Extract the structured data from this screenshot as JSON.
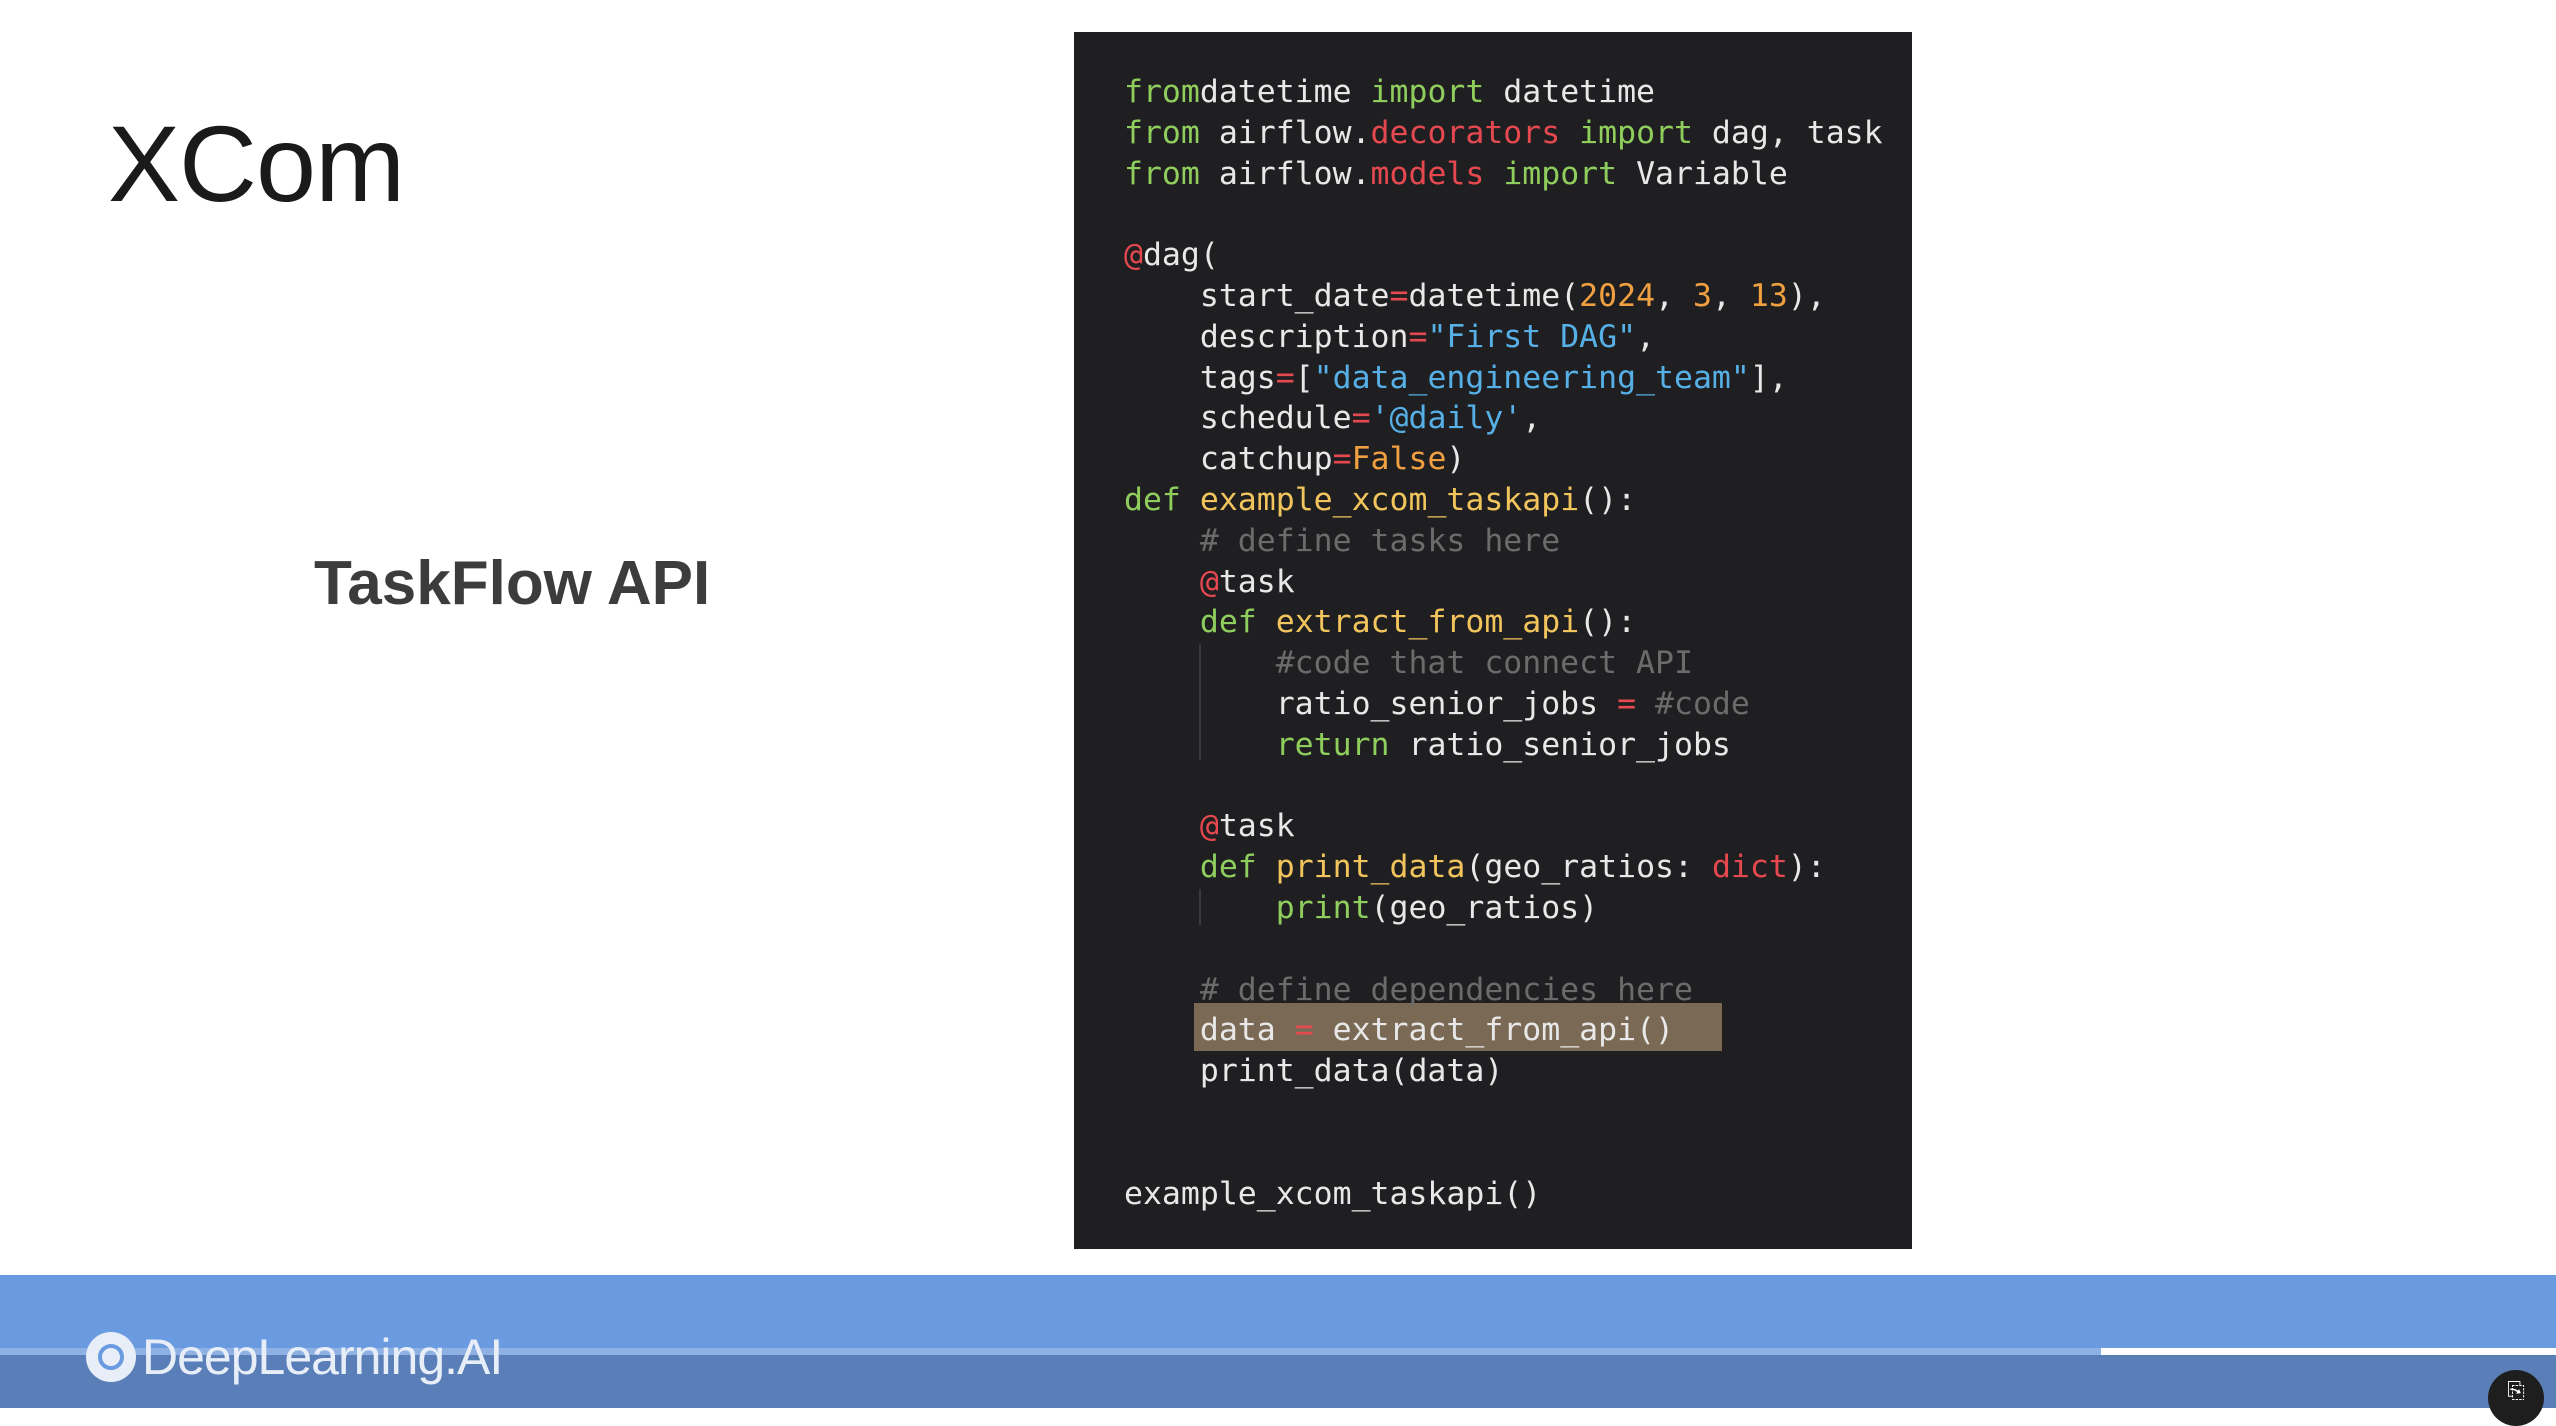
{
  "slide": {
    "title": "XCom",
    "subtitle": "TaskFlow API"
  },
  "code": {
    "lines": [
      [
        [
          "kw",
          "from"
        ],
        [
          "",
          "datetime "
        ],
        [
          "kw",
          "import"
        ],
        [
          "",
          " datetime"
        ]
      ],
      [
        [
          "kw",
          "from"
        ],
        [
          "",
          " airflow."
        ],
        [
          "mod",
          "decorators"
        ],
        [
          "",
          " "
        ],
        [
          "kw",
          "import"
        ],
        [
          "",
          " dag, task"
        ]
      ],
      [
        [
          "kw",
          "from"
        ],
        [
          "",
          " airflow."
        ],
        [
          "mod",
          "models"
        ],
        [
          "",
          " "
        ],
        [
          "kw",
          "import"
        ],
        [
          "",
          " Variable"
        ]
      ],
      [],
      [
        [
          "deco",
          "@"
        ],
        [
          "",
          "dag("
        ]
      ],
      [
        [
          "",
          "    start_date"
        ],
        [
          "mod",
          "="
        ],
        [
          "",
          "datetime("
        ],
        [
          "num",
          "2024"
        ],
        [
          "",
          ", "
        ],
        [
          "num",
          "3"
        ],
        [
          "",
          ", "
        ],
        [
          "num",
          "13"
        ],
        [
          "",
          "),"
        ]
      ],
      [
        [
          "",
          "    description"
        ],
        [
          "mod",
          "="
        ],
        [
          "str",
          "\"First DAG\""
        ],
        [
          "",
          ","
        ]
      ],
      [
        [
          "",
          "    tags"
        ],
        [
          "mod",
          "="
        ],
        [
          "",
          "["
        ],
        [
          "str",
          "\"data_engineering_team\""
        ],
        [
          "",
          "],"
        ]
      ],
      [
        [
          "",
          "    schedule"
        ],
        [
          "mod",
          "="
        ],
        [
          "str",
          "'@daily'"
        ],
        [
          "",
          ","
        ]
      ],
      [
        [
          "",
          "    catchup"
        ],
        [
          "mod",
          "="
        ],
        [
          "num",
          "False"
        ],
        [
          "",
          ")"
        ]
      ],
      [
        [
          "kw",
          "def"
        ],
        [
          "",
          " "
        ],
        [
          "fn",
          "example_xcom_taskapi"
        ],
        [
          "",
          "():"
        ]
      ],
      [
        [
          "cmt",
          "    # define tasks here"
        ]
      ],
      [
        [
          "",
          "    "
        ],
        [
          "deco",
          "@"
        ],
        [
          "",
          "task"
        ]
      ],
      [
        [
          "",
          "    "
        ],
        [
          "kw",
          "def"
        ],
        [
          "",
          " "
        ],
        [
          "fn",
          "extract_from_api"
        ],
        [
          "",
          "():"
        ]
      ],
      [
        [
          "cmt",
          "        #code that connect API"
        ]
      ],
      [
        [
          "",
          "        ratio_senior_jobs "
        ],
        [
          "mod",
          "="
        ],
        [
          "",
          " "
        ],
        [
          "cmt",
          "#code"
        ]
      ],
      [
        [
          "",
          "        "
        ],
        [
          "kw",
          "return"
        ],
        [
          "",
          " ratio_senior_jobs"
        ]
      ],
      [],
      [
        [
          "",
          "    "
        ],
        [
          "deco",
          "@"
        ],
        [
          "",
          "task"
        ]
      ],
      [
        [
          "",
          "    "
        ],
        [
          "kw",
          "def"
        ],
        [
          "",
          " "
        ],
        [
          "fn",
          "print_data"
        ],
        [
          "",
          "(geo_ratios: "
        ],
        [
          "typ",
          "dict"
        ],
        [
          "",
          "):"
        ]
      ],
      [
        [
          "",
          "        "
        ],
        [
          "kw",
          "print"
        ],
        [
          "",
          "(geo_ratios)"
        ]
      ],
      [],
      [
        [
          "cmt",
          "    # define dependencies here"
        ]
      ],
      [
        [
          "",
          "    data "
        ],
        [
          "mod",
          "="
        ],
        [
          "",
          " extract_from_api()"
        ]
      ],
      [
        [
          "",
          "    print_data(data)"
        ]
      ],
      [],
      [],
      [
        [
          "",
          "example_xcom_taskapi()"
        ]
      ]
    ]
  },
  "brand": {
    "logo_text": "DeepLearning.AI",
    "logo_icon": "deeplearning-ai-logo-icon"
  },
  "player": {
    "progress_fraction": 0.0,
    "buffered_start_fraction": 0.822,
    "buffered_end_fraction": 1.0,
    "captions_icon": "closed-captions-icon",
    "captions_label": "⎘"
  }
}
